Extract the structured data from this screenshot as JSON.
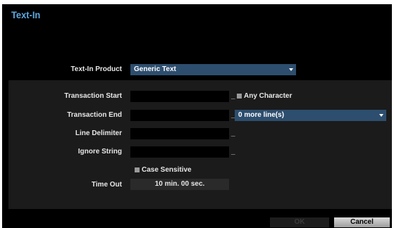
{
  "window": {
    "title": "Text-In"
  },
  "product": {
    "label": "Text-In Product",
    "value": "Generic Text"
  },
  "fields": {
    "transaction_start": {
      "label": "Transaction Start",
      "value": ""
    },
    "transaction_end": {
      "label": "Transaction End",
      "value": ""
    },
    "line_delimiter": {
      "label": "Line Delimiter",
      "value": ""
    },
    "ignore_string": {
      "label": "Ignore String",
      "value": ""
    },
    "cursor_glyph": "_"
  },
  "options": {
    "any_character": {
      "label": "Any Character",
      "checked": false
    },
    "more_lines": {
      "value": "0 more line(s)"
    },
    "case_sensitive": {
      "label": "Case Sensitive",
      "checked": false
    }
  },
  "timeout": {
    "label": "Time Out",
    "value": "10 min. 00 sec."
  },
  "buttons": {
    "ok": "OK",
    "cancel": "Cancel"
  },
  "colors": {
    "title": "#5fa8e0",
    "dropdown": "#2d4e6e",
    "panel": "#1b1b1b",
    "background": "#000000"
  }
}
